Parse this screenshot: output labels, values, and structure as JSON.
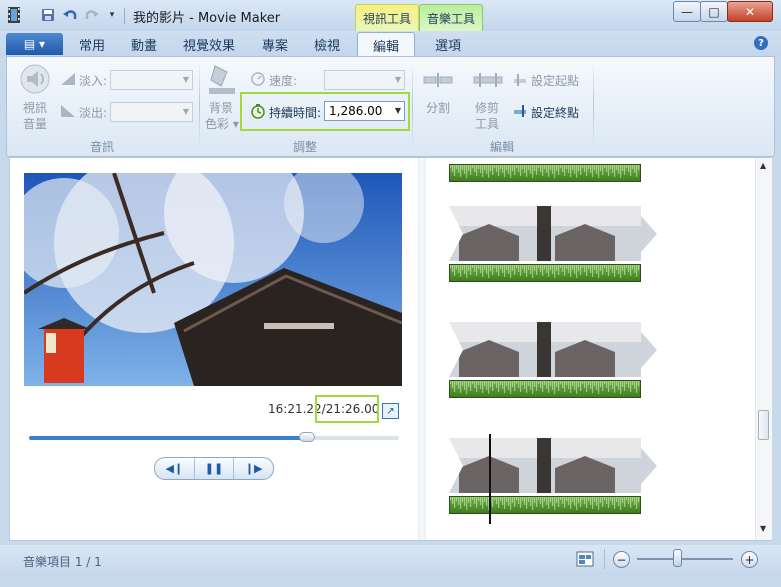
{
  "titlebar": {
    "title": "我的影片 - Movie Maker",
    "context_tabs": {
      "video_tools": "視訊工具",
      "music_tools": "音樂工具"
    },
    "window_buttons": {
      "minimize": "—",
      "maximize": "□",
      "close": "✕"
    }
  },
  "tabs": {
    "file": "▤ ▾",
    "items": [
      "常用",
      "動畫",
      "視覺效果",
      "專案",
      "檢視",
      "編輯",
      "選項"
    ],
    "active": "編輯",
    "help": "?"
  },
  "ribbon": {
    "audio": {
      "volume_label_1": "視訊",
      "volume_label_2": "音量",
      "fade_in": "淡入:",
      "fade_out": "淡出:",
      "group": "音訊"
    },
    "adjust": {
      "bg_color_label_1": "背景",
      "bg_color_label_2": "色彩 ▾",
      "speed": "速度:",
      "duration": "持續時間:",
      "duration_value": "1,286.00",
      "group": "調整"
    },
    "edit": {
      "split": "分割",
      "trim_1": "修剪",
      "trim_2": "工具",
      "set_start": "設定起點",
      "set_end": "設定終點",
      "group": "編輯"
    }
  },
  "preview": {
    "time_current": "16:21.22",
    "time_total": "/21:26.00",
    "seek_progress": 0.75
  },
  "status": {
    "text": "音樂項目 1 / 1",
    "zoom_level": 0.42
  },
  "colors": {
    "accent": "#1f5ba8",
    "highlight": "#a3d93a",
    "audio_wave": "#4f8f2a"
  }
}
